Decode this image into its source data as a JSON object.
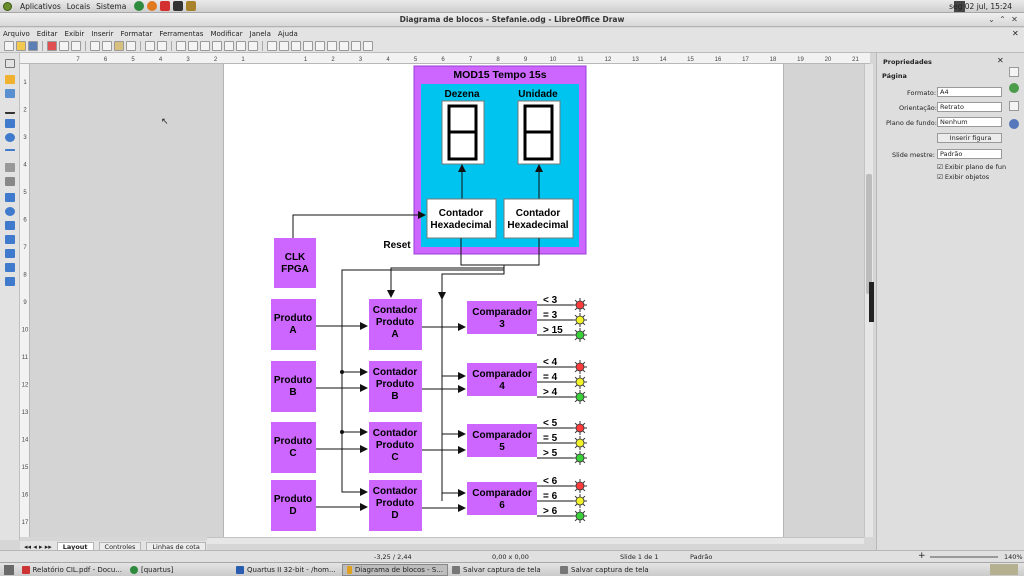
{
  "topbar": {
    "menus": [
      "Aplicativos",
      "Locais",
      "Sistema"
    ],
    "clock": "seg 02 jul, 15:24"
  },
  "window": {
    "title": "Diagrama de blocos - Stefanie.odg - LibreOffice Draw"
  },
  "menubar": [
    "Arquivo",
    "Editar",
    "Exibir",
    "Inserir",
    "Formatar",
    "Ferramentas",
    "Modificar",
    "Janela",
    "Ajuda"
  ],
  "ruler": {
    "h_ticks": [
      "1",
      "2",
      "3",
      "4",
      "5",
      "6",
      "7",
      "8",
      "9",
      "10",
      "11",
      "12",
      "13",
      "14",
      "15",
      "16",
      "17",
      "18",
      "19",
      "20",
      "21"
    ],
    "left_ticks": [
      "7",
      "6",
      "5",
      "4",
      "3",
      "2",
      "1"
    ],
    "v_ticks": [
      "1",
      "2",
      "3",
      "4",
      "5",
      "6",
      "7",
      "8",
      "9",
      "10",
      "11",
      "12",
      "13",
      "14",
      "15",
      "16",
      "17"
    ]
  },
  "diagram": {
    "module_title": "MOD15 Tempo 15s",
    "dezena": "Dezena",
    "unidade": "Unidade",
    "contador_hex": [
      "Contador",
      "Hexadecimal"
    ],
    "reset": "Reset",
    "clk": [
      "CLK",
      "FPGA"
    ],
    "produtos": [
      [
        "Produto",
        "A"
      ],
      [
        "Produto",
        "B"
      ],
      [
        "Produto",
        "C"
      ],
      [
        "Produto",
        "D"
      ]
    ],
    "contadores": [
      [
        "Contador",
        "Produto",
        "A"
      ],
      [
        "Contador",
        "Produto",
        "B"
      ],
      [
        "Contador",
        "Produto",
        "C"
      ],
      [
        "Contador",
        "Produto",
        "D"
      ]
    ],
    "comparadores": [
      [
        "Comparador",
        "3"
      ],
      [
        "Comparador",
        "4"
      ],
      [
        "Comparador",
        "5"
      ],
      [
        "Comparador",
        "6"
      ]
    ],
    "outputs": [
      [
        "< 3",
        "= 3",
        "> 15"
      ],
      [
        "< 4",
        "= 4",
        "> 4"
      ],
      [
        "< 5",
        "= 5",
        "> 5"
      ],
      [
        "< 6",
        "= 6",
        "> 6"
      ]
    ],
    "colors": {
      "module": "#cc66ff",
      "display_bg": "#00c4f0",
      "block": "#cc66ff",
      "led_red": "#ff3b3b",
      "led_yellow": "#f2f22a",
      "led_green": "#3ad13a"
    }
  },
  "tabs": [
    "Layout",
    "Controles",
    "Linhas de cota"
  ],
  "status": {
    "position": "-3,25 / 2,44",
    "size": "0,00 x 0,00",
    "slide": "Slide 1 de 1",
    "master": "Padrão",
    "zoom": "140%"
  },
  "sidebar": {
    "title": "Propriedades",
    "section": "Página",
    "formato_label": "Formato:",
    "formato_value": "A4",
    "orientacao_label": "Orientação:",
    "orientacao_value": "Retrato",
    "plano_label": "Plano de fundo:",
    "plano_value": "Nenhum",
    "inserir_figura": "Inserir figura",
    "slide_mestre_label": "Slide mestre:",
    "slide_mestre_value": "Padrão",
    "exibir_plano": "Exibir plano de fun",
    "exibir_objetos": "Exibir objetos"
  },
  "taskbar": [
    {
      "label": "Relatório CIL.pdf - Docu...",
      "active": false
    },
    {
      "label": "[quartus]",
      "active": false
    },
    {
      "label": "Quartus II 32-bit - /hom...",
      "active": false
    },
    {
      "label": "Diagrama de blocos - S...",
      "active": true
    },
    {
      "label": "Salvar captura de tela",
      "active": false
    },
    {
      "label": "Salvar captura de tela",
      "active": false
    }
  ]
}
